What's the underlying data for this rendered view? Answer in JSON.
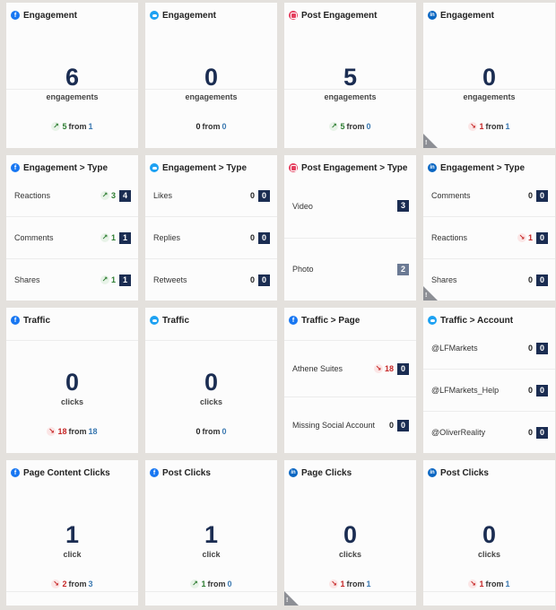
{
  "colors": {
    "facebook": "#1877f2",
    "twitter": "#1da1f2",
    "instagram": "#e4405f",
    "linkedin": "#0a66c2",
    "value": "#1b2d52",
    "up": "#2e7d32",
    "down": "#c62828",
    "previous": "#3a78b0"
  },
  "cards": {
    "fb_engagement": {
      "network": "facebook",
      "title": "Engagement",
      "value": "6",
      "unit": "engagements",
      "change": "5",
      "from_label": "from",
      "previous": "1",
      "direction": "up"
    },
    "tw_engagement": {
      "network": "twitter",
      "title": "Engagement",
      "value": "0",
      "unit": "engagements",
      "change": "0",
      "from_label": "from",
      "previous": "0",
      "direction": "flat"
    },
    "ig_engagement": {
      "network": "instagram",
      "title": "Post Engagement",
      "value": "5",
      "unit": "engagements",
      "change": "5",
      "from_label": "from",
      "previous": "0",
      "direction": "up"
    },
    "li_engagement": {
      "network": "linkedin",
      "title": "Engagement",
      "value": "0",
      "unit": "engagements",
      "change": "1",
      "from_label": "from",
      "previous": "1",
      "direction": "down",
      "warning": true
    },
    "fb_engagement_type": {
      "network": "facebook",
      "title": "Engagement > Type",
      "rows": [
        {
          "label": "Reactions",
          "delta": "3",
          "direction": "up",
          "value": "4"
        },
        {
          "label": "Comments",
          "delta": "1",
          "direction": "up",
          "value": "1"
        },
        {
          "label": "Shares",
          "delta": "1",
          "direction": "up",
          "value": "1"
        }
      ]
    },
    "tw_engagement_type": {
      "network": "twitter",
      "title": "Engagement > Type",
      "rows": [
        {
          "label": "Likes",
          "delta": "0",
          "direction": "flat",
          "value": "0"
        },
        {
          "label": "Replies",
          "delta": "0",
          "direction": "flat",
          "value": "0"
        },
        {
          "label": "Retweets",
          "delta": "0",
          "direction": "flat",
          "value": "0"
        }
      ]
    },
    "ig_engagement_type": {
      "network": "instagram",
      "title": "Post Engagement > Type",
      "rows": [
        {
          "label": "Video",
          "value": "3"
        },
        {
          "label": "Photo",
          "value": "2"
        }
      ]
    },
    "li_engagement_type": {
      "network": "linkedin",
      "title": "Engagement > Type",
      "warning": true,
      "rows": [
        {
          "label": "Comments",
          "delta": "0",
          "direction": "flat",
          "value": "0"
        },
        {
          "label": "Reactions",
          "delta": "1",
          "direction": "down",
          "value": "0"
        },
        {
          "label": "Shares",
          "delta": "0",
          "direction": "flat",
          "value": "0"
        }
      ]
    },
    "fb_traffic": {
      "network": "facebook",
      "title": "Traffic",
      "value": "0",
      "unit": "clicks",
      "change": "18",
      "from_label": "from",
      "previous": "18",
      "direction": "down"
    },
    "tw_traffic": {
      "network": "twitter",
      "title": "Traffic",
      "value": "0",
      "unit": "clicks",
      "change": "0",
      "from_label": "from",
      "previous": "0",
      "direction": "flat"
    },
    "fb_traffic_page": {
      "network": "facebook",
      "title": "Traffic > Page",
      "rows": [
        {
          "label": "Athene Suites",
          "delta": "18",
          "direction": "down",
          "value": "0"
        },
        {
          "label": "Missing Social Account",
          "delta": "0",
          "direction": "flat",
          "value": "0"
        }
      ]
    },
    "tw_traffic_account": {
      "network": "twitter",
      "title": "Traffic > Account",
      "rows": [
        {
          "label": "@LFMarkets",
          "delta": "0",
          "direction": "flat",
          "value": "0"
        },
        {
          "label": "@LFMarkets_Help",
          "delta": "0",
          "direction": "flat",
          "value": "0"
        },
        {
          "label": "@OliverReality",
          "delta": "0",
          "direction": "flat",
          "value": "0"
        }
      ]
    },
    "fb_page_content_clicks": {
      "network": "facebook",
      "title": "Page Content Clicks",
      "value": "1",
      "unit": "click",
      "change": "2",
      "from_label": "from",
      "previous": "3",
      "direction": "down"
    },
    "fb_post_clicks": {
      "network": "facebook",
      "title": "Post Clicks",
      "value": "1",
      "unit": "click",
      "change": "1",
      "from_label": "from",
      "previous": "0",
      "direction": "up"
    },
    "li_page_clicks": {
      "network": "linkedin",
      "title": "Page Clicks",
      "value": "0",
      "unit": "clicks",
      "change": "1",
      "from_label": "from",
      "previous": "1",
      "direction": "down",
      "warning": true
    },
    "li_post_clicks": {
      "network": "linkedin",
      "title": "Post Clicks",
      "value": "0",
      "unit": "clicks",
      "change": "1",
      "from_label": "from",
      "previous": "1",
      "direction": "down"
    }
  },
  "icons": {
    "up": "↗",
    "down": "↘",
    "warning": "!"
  }
}
